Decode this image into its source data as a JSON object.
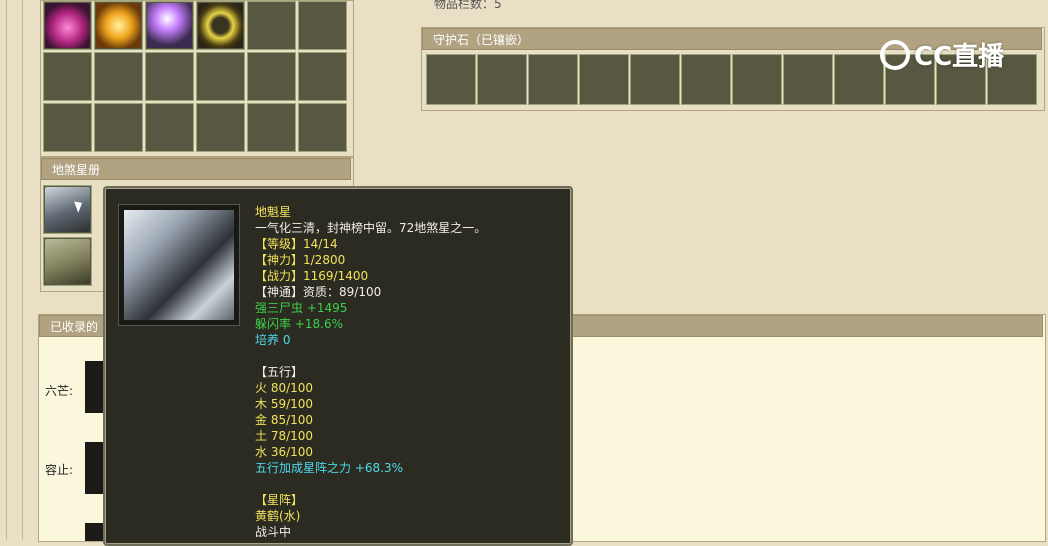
{
  "inventory": {
    "count_label": "物品栏数：5"
  },
  "guard_stone": {
    "title": "守护石（已镶嵌）"
  },
  "star_book": {
    "title": "地煞星册"
  },
  "collected": {
    "title": "已收录的",
    "rows": [
      {
        "label": "六芒:"
      },
      {
        "label": "容止:"
      }
    ]
  },
  "tooltip": {
    "name": "地魁星",
    "desc": "一气化三清，封神榜中留。72地煞星之一。",
    "stats": [
      {
        "text": "【等级】14/14",
        "color": "yellow"
      },
      {
        "text": "【神力】1/2800",
        "color": "yellow"
      },
      {
        "text": "【战力】1169/1400",
        "color": "yellow"
      },
      {
        "text": "【神通】资质：89/100",
        "color": "white"
      },
      {
        "text": "强三尸虫 +1495",
        "color": "green"
      },
      {
        "text": "躲闪率 +18.6%",
        "color": "green"
      },
      {
        "text": "培养 0",
        "color": "cyan"
      },
      {
        "text": "",
        "color": "white"
      },
      {
        "text": "【五行】",
        "color": "white"
      },
      {
        "text": "火 80/100",
        "color": "yellow"
      },
      {
        "text": "木 59/100",
        "color": "yellow"
      },
      {
        "text": "金 85/100",
        "color": "yellow"
      },
      {
        "text": "土 78/100",
        "color": "yellow"
      },
      {
        "text": "水 36/100",
        "color": "yellow"
      },
      {
        "text": "五行加成星阵之力 +68.3%",
        "color": "cyan"
      },
      {
        "text": "",
        "color": "white"
      },
      {
        "text": "【星阵】",
        "color": "yellow"
      },
      {
        "text": "黄鹤(水)",
        "color": "yellow"
      },
      {
        "text": "战斗中",
        "color": "white"
      }
    ]
  },
  "watermark": {
    "text": "CC直播"
  },
  "icons": [
    "lantern-icon",
    "golden-orb-icon",
    "sparkle-staff-icon",
    "yellow-ring-icon"
  ],
  "colors": {
    "panel": "#575742",
    "bg": "#e9dfc4",
    "header": "#b1a382",
    "tooltip_bg": "#2b2b22"
  }
}
